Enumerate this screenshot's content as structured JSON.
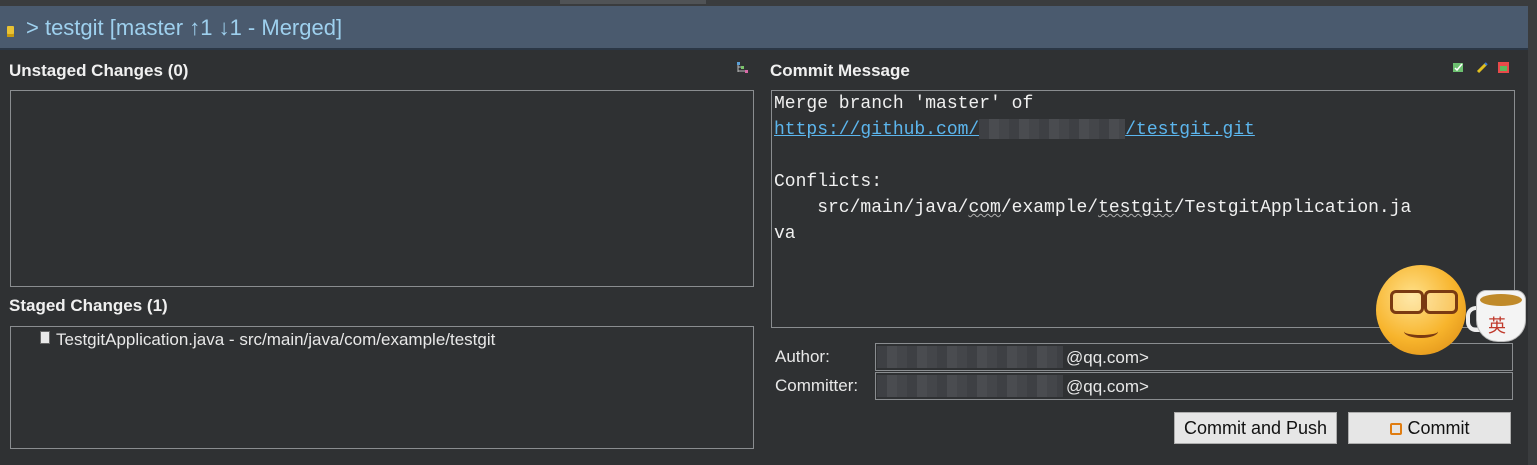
{
  "header": {
    "title": "> testgit [master ↑1 ↓1 - Merged]"
  },
  "unstaged": {
    "label": "Unstaged Changes (0)"
  },
  "staged": {
    "label": "Staged Changes (1)",
    "items": [
      {
        "name": "TestgitApplication.java - src/main/java/com/example/testgit"
      }
    ]
  },
  "commit": {
    "label": "Commit Message",
    "message_line1": "Merge branch 'master' of",
    "link_prefix": "https://github.com/",
    "link_suffix": "/testgit.git",
    "conflicts_label": "Conflicts:",
    "conflict_path_prefix": "    src/main/java/",
    "conflict_com": "com",
    "conflict_mid": "/example/",
    "conflict_testgit": "testgit",
    "conflict_rest": "/TestgitApplication.ja",
    "conflict_wrap": "va"
  },
  "author": {
    "label": "Author:",
    "value_suffix": "@qq.com>"
  },
  "committer": {
    "label": "Committer:",
    "value_suffix": "@qq.com>"
  },
  "buttons": {
    "commit_and_push": "Commit and Push",
    "commit": "Commit"
  },
  "overlay": {
    "cup_text": "英"
  }
}
